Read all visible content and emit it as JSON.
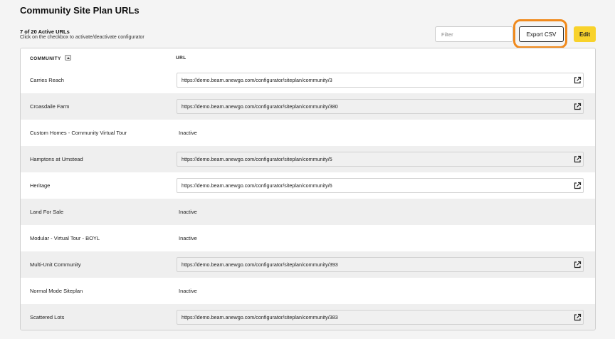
{
  "header": {
    "title": "Community Site Plan URLs",
    "count": "7 of 20 Active URLs",
    "hint": "Click on the checkbox to activate/deactivate configurator"
  },
  "toolbar": {
    "filter_placeholder": "Filter",
    "export_label": "Export CSV",
    "edit_label": "Edit"
  },
  "table": {
    "columns": {
      "community": "COMMUNITY",
      "url": "URL"
    },
    "rows": [
      {
        "community": "Carries Reach",
        "url": "https://demo.beam.anewgo.com/configurator/siteplan/community/3"
      },
      {
        "community": "Croasdaile Farm",
        "url": "https://demo.beam.anewgo.com/configurator/siteplan/community/380"
      },
      {
        "community": "Custom Homes - Community Virtual Tour",
        "url": "Inactive"
      },
      {
        "community": "Hamptons at Umstead",
        "url": "https://demo.beam.anewgo.com/configurator/siteplan/community/5"
      },
      {
        "community": "Heritage",
        "url": "https://demo.beam.anewgo.com/configurator/siteplan/community/6"
      },
      {
        "community": "Land For Sale",
        "url": "Inactive"
      },
      {
        "community": "Modular - Virtual Tour - BOYL",
        "url": "Inactive"
      },
      {
        "community": "Multi-Unit Community",
        "url": "https://demo.beam.anewgo.com/configurator/siteplan/community/393"
      },
      {
        "community": "Normal Mode Siteplan",
        "url": "Inactive"
      },
      {
        "community": "Scattered Lots",
        "url": "https://demo.beam.anewgo.com/configurator/siteplan/community/383"
      }
    ]
  },
  "icons": {
    "sort": "chevron-up-icon",
    "open": "external-link-icon"
  },
  "colors": {
    "accent": "#f8d22b",
    "highlight": "#f08a1d",
    "row_alt": "#efefef"
  }
}
